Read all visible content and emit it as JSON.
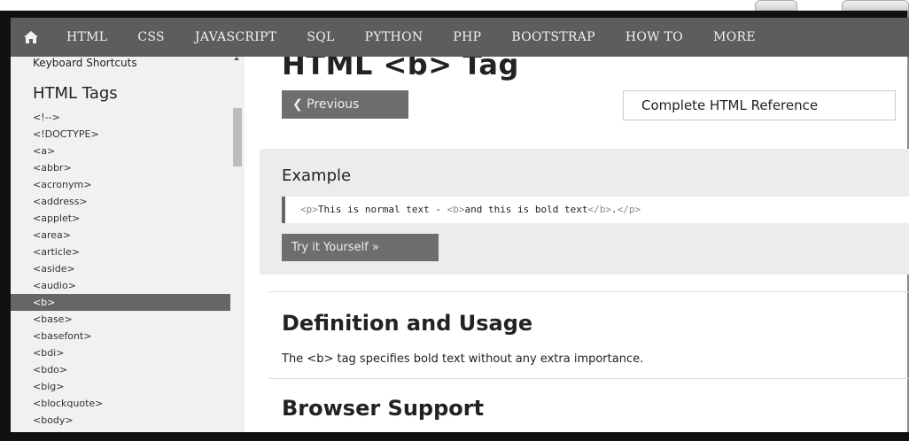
{
  "topnav": {
    "home_icon": "home-icon",
    "items": [
      "HTML",
      "CSS",
      "JAVASCRIPT",
      "SQL",
      "PYTHON",
      "PHP",
      "BOOTSTRAP",
      "HOW TO",
      "MORE"
    ]
  },
  "sidebar": {
    "shortcuts_label": "Keyboard Shortcuts",
    "heading": "HTML Tags",
    "items": [
      {
        "label": "<!-->",
        "active": false
      },
      {
        "label": "<!DOCTYPE>",
        "active": false
      },
      {
        "label": "<a>",
        "active": false
      },
      {
        "label": "<abbr>",
        "active": false
      },
      {
        "label": "<acronym>",
        "active": false
      },
      {
        "label": "<address>",
        "active": false
      },
      {
        "label": "<applet>",
        "active": false
      },
      {
        "label": "<area>",
        "active": false
      },
      {
        "label": "<article>",
        "active": false
      },
      {
        "label": "<aside>",
        "active": false
      },
      {
        "label": "<audio>",
        "active": false
      },
      {
        "label": "<b>",
        "active": true
      },
      {
        "label": "<base>",
        "active": false
      },
      {
        "label": "<basefont>",
        "active": false
      },
      {
        "label": "<bdi>",
        "active": false
      },
      {
        "label": "<bdo>",
        "active": false
      },
      {
        "label": "<big>",
        "active": false
      },
      {
        "label": "<blockquote>",
        "active": false
      },
      {
        "label": "<body>",
        "active": false
      }
    ]
  },
  "main": {
    "title": "HTML <b> Tag",
    "prev_button": "❮ Previous",
    "reference_button": "Complete HTML Reference",
    "example": {
      "title": "Example",
      "code_open_p": "<p>",
      "code_text_1": "This is normal text - ",
      "code_open_b": "<b>",
      "code_text_2": "and this is bold text",
      "code_close_b": "</b>",
      "code_text_3": ".",
      "code_close_p": "</p>",
      "try_button": "Try it Yourself »"
    },
    "definition": {
      "title": "Definition and Usage",
      "text": "The <b> tag specifies bold text without any extra importance."
    },
    "browser_support": {
      "title": "Browser Support"
    }
  },
  "colors": {
    "nav_bg": "#5d5d5d",
    "sidebar_bg": "#f1f1f1",
    "active_item_bg": "#666666",
    "example_bg": "#ececec",
    "button_bg": "#6e6e6e"
  }
}
